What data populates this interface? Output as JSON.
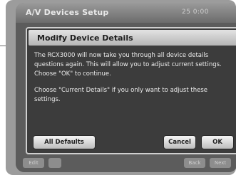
{
  "window": {
    "title": "A/V Devices Setup",
    "status": "25 0:00"
  },
  "dialog": {
    "title": "Modify Device Details",
    "body_paragraph_1": "The RCX3000 will now take you through all device details questions again. This will allow you to adjust current settings. Choose \"OK\" to continue.",
    "body_paragraph_2": "Choose \"Current Details\" if you only want to adjust these settings."
  },
  "buttons": {
    "defaults_label": "All Defaults",
    "cancel_label": "Cancel",
    "ok_label": "OK"
  },
  "background_buttons": {
    "left_1": "Edit",
    "left_2": "",
    "right_1": "Back",
    "right_2": "Next"
  },
  "colors": {
    "dialog_background": "#3c3c3c",
    "dialog_header": "#d0d0d0",
    "screen_background": "#6f6f6f"
  }
}
